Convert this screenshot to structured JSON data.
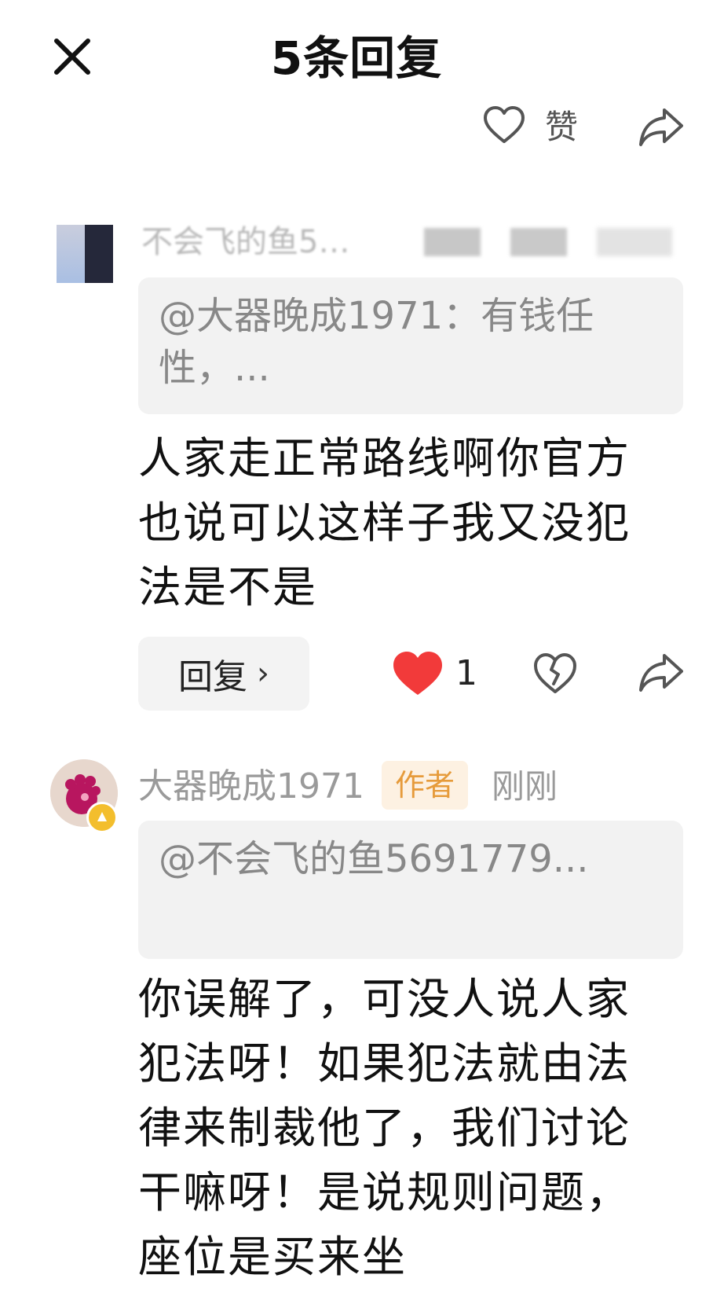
{
  "header": {
    "close_icon": "close-icon",
    "title": "5条回复",
    "like_label": "赞",
    "like_icon": "heart-outline-icon",
    "share_icon": "share-arrow-icon"
  },
  "comments": [
    {
      "username": "不会飞的鱼5…",
      "quote": "@大器晚成1971：有钱任性，...",
      "body": "人家走正常路线啊你官方也说可以这样子我又没犯法是不是",
      "reply_label": "回复",
      "likes": "1"
    },
    {
      "username": "大器晚成1971",
      "author_tag": "作者",
      "time": "刚刚",
      "quote": "@不会飞的鱼5691779...",
      "body": "你误解了，可没人说人家犯法呀！如果犯法就由法律来制裁他了，我们讨论干嘛呀！是说规则问题，座位是买来坐"
    }
  ],
  "colors": {
    "liked_heart": "#f23a3a",
    "author_tag_text": "#e69b3b",
    "author_tag_bg": "#fdf1e2",
    "quote_bg": "#f2f2f2"
  }
}
